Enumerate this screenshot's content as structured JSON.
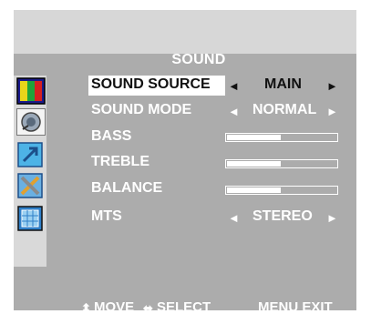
{
  "menu": {
    "title": "SOUND",
    "rows": [
      {
        "label": "SOUND SOURCE",
        "value": "MAIN",
        "left_arrow": "◄",
        "right_arrow": "►"
      },
      {
        "label": "SOUND MODE",
        "value": "NORMAL",
        "left_arrow": "◄",
        "right_arrow": "►"
      },
      {
        "label": "BASS",
        "level": 0.5
      },
      {
        "label": "TREBLE",
        "level": 0.5
      },
      {
        "label": "BALANCE",
        "level": 0.5
      },
      {
        "label": "MTS",
        "value": "STEREO",
        "left_arrow": "◄",
        "right_arrow": "►"
      }
    ],
    "selected_row": "SOUND SOURCE"
  },
  "sidebar": {
    "icons": [
      "picture-icon",
      "sound-icon",
      "channel-icon",
      "setup-icon",
      "feature-icon"
    ],
    "active": "sound-icon"
  },
  "footer": {
    "move_symbol": "⬍",
    "move_label": "MOVE",
    "select_symbol": "⬌",
    "select_label": "SELECT",
    "exit_label": "MENU  EXIT"
  }
}
